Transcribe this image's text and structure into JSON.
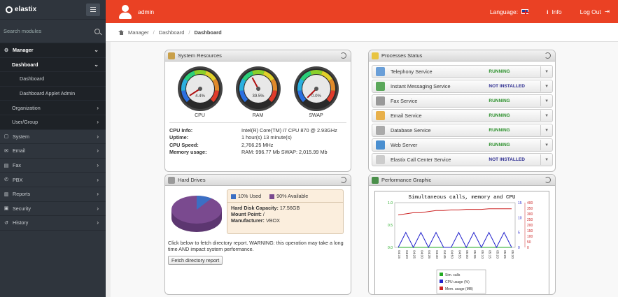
{
  "sidebar": {
    "logo": "elastix",
    "search_placeholder": "Search modules",
    "items": [
      {
        "label": "Manager",
        "icon": "gear-icon",
        "glyph": "⚙",
        "chev": "⌄"
      },
      {
        "label": "Dashboard",
        "chev": "⌄"
      },
      {
        "label": "Dashboard"
      },
      {
        "label": "Dashboard Applet Admin"
      },
      {
        "label": "Organization",
        "chev": "›"
      },
      {
        "label": "User/Group",
        "chev": "›"
      },
      {
        "label": "System",
        "icon": "system-icon",
        "glyph": "▢",
        "chev": "›"
      },
      {
        "label": "Email",
        "icon": "email-icon",
        "glyph": "✉",
        "chev": "›"
      },
      {
        "label": "Fax",
        "icon": "fax-icon",
        "glyph": "▤",
        "chev": "›"
      },
      {
        "label": "PBX",
        "icon": "phone-icon",
        "glyph": "✆",
        "chev": "›"
      },
      {
        "label": "Reports",
        "icon": "reports-icon",
        "glyph": "▥",
        "chev": "›"
      },
      {
        "label": "Security",
        "icon": "lock-icon",
        "glyph": "▣",
        "chev": "›"
      },
      {
        "label": "History",
        "icon": "history-icon",
        "glyph": "↺",
        "chev": "›"
      }
    ]
  },
  "topbar": {
    "user": "admin",
    "language_label": "Language:",
    "info_label": "Info",
    "logout_label": "Log Out",
    "info_glyph": "i",
    "logout_glyph": "⇥"
  },
  "breadcrumb": {
    "items": [
      "Manager",
      "Dashboard",
      "Dashboard"
    ]
  },
  "system_resources": {
    "title": "System Resources",
    "gauges": [
      {
        "label": "CPU",
        "value_text": "4.4%",
        "value": 4.4
      },
      {
        "label": "RAM",
        "value_text": "39.5%",
        "value": 39.5
      },
      {
        "label": "SWAP",
        "value_text": "0.0%",
        "value": 0.0
      }
    ],
    "info": [
      {
        "key": "CPU Info:",
        "value": "Intel(R) Core(TM) i7 CPU 870 @ 2.93GHz"
      },
      {
        "key": "Uptime:",
        "value": "1 hour(s) 13 minute(s)"
      },
      {
        "key": "CPU Speed:",
        "value": "2,766.25 MHz"
      },
      {
        "key": "Memory usage:",
        "value": "RAM: 996.77 Mb SWAP: 2,015.99 Mb"
      }
    ]
  },
  "processes": {
    "title": "Processes Status",
    "items": [
      {
        "name": "Telephony Service",
        "status": "RUNNING",
        "state": "running",
        "icon_color": "#6a9fd8"
      },
      {
        "name": "Instant Messaging Service",
        "status": "NOT INSTALLED",
        "state": "notinst",
        "icon_color": "#5ba85b"
      },
      {
        "name": "Fax Service",
        "status": "RUNNING",
        "state": "running",
        "icon_color": "#999999"
      },
      {
        "name": "Email Service",
        "status": "RUNNING",
        "state": "running",
        "icon_color": "#e8b04a"
      },
      {
        "name": "Database Service",
        "status": "RUNNING",
        "state": "running",
        "icon_color": "#aaaaaa"
      },
      {
        "name": "Web Server",
        "status": "RUNNING",
        "state": "running",
        "icon_color": "#4a8fd0"
      },
      {
        "name": "Elastix Call Center Service",
        "status": "NOT INSTALLED",
        "state": "notinst",
        "icon_color": "#cccccc"
      }
    ]
  },
  "hard_drives": {
    "title": "Hard Drives",
    "used_label": "10% Used",
    "available_label": "90% Available",
    "used_pct": 10,
    "used_color": "#3b6fc4",
    "available_color": "#7a4a8f",
    "capacity_key": "Hard Disk Capacity:",
    "capacity_value": "17.56GB",
    "mount_key": "Mount Point:",
    "mount_value": "/",
    "manufacturer_key": "Manufacturer:",
    "manufacturer_value": "VBOX",
    "note": "Click below to fetch directory report. WARNING: this operation may take a long time AND impact system performance.",
    "button": "Fetch directory report"
  },
  "performance": {
    "title": "Performance Graphic",
    "chart_data": {
      "type": "line",
      "title": "Simultaneous calls, memory and CPU",
      "x": [
        "04:15",
        "04:20",
        "04:25",
        "04:30",
        "04:35",
        "04:40",
        "04:45",
        "04:50",
        "04:55",
        "05:00",
        "05:05",
        "05:10",
        "05:15",
        "05:20",
        "05:25",
        "05:30"
      ],
      "yticks_left": [
        "0.0",
        "0.5",
        "1.0"
      ],
      "yticks_mid": [
        "0",
        "5",
        "10",
        "15"
      ],
      "yticks_right": [
        "0",
        "50",
        "100",
        "150",
        "200",
        "250",
        "300",
        "350",
        "400"
      ],
      "series": [
        {
          "name": "Sim. calls",
          "color": "#22aa22",
          "axis": "left",
          "values": [
            0,
            0,
            0,
            0,
            0,
            0,
            0,
            0,
            0,
            0,
            0,
            0,
            0,
            0,
            0,
            0
          ]
        },
        {
          "name": "CPU usage (%)",
          "color": "#2222cc",
          "axis": "mid",
          "values": [
            0,
            5,
            0,
            5,
            0,
            5,
            0,
            0,
            5,
            0,
            5,
            0,
            5,
            0,
            5,
            0
          ]
        },
        {
          "name": "Mem. usage (MB)",
          "color": "#cc2222",
          "axis": "right",
          "values": [
            290,
            300,
            310,
            310,
            320,
            330,
            330,
            335,
            335,
            340,
            340,
            340,
            345,
            345,
            345,
            345
          ]
        }
      ]
    }
  }
}
